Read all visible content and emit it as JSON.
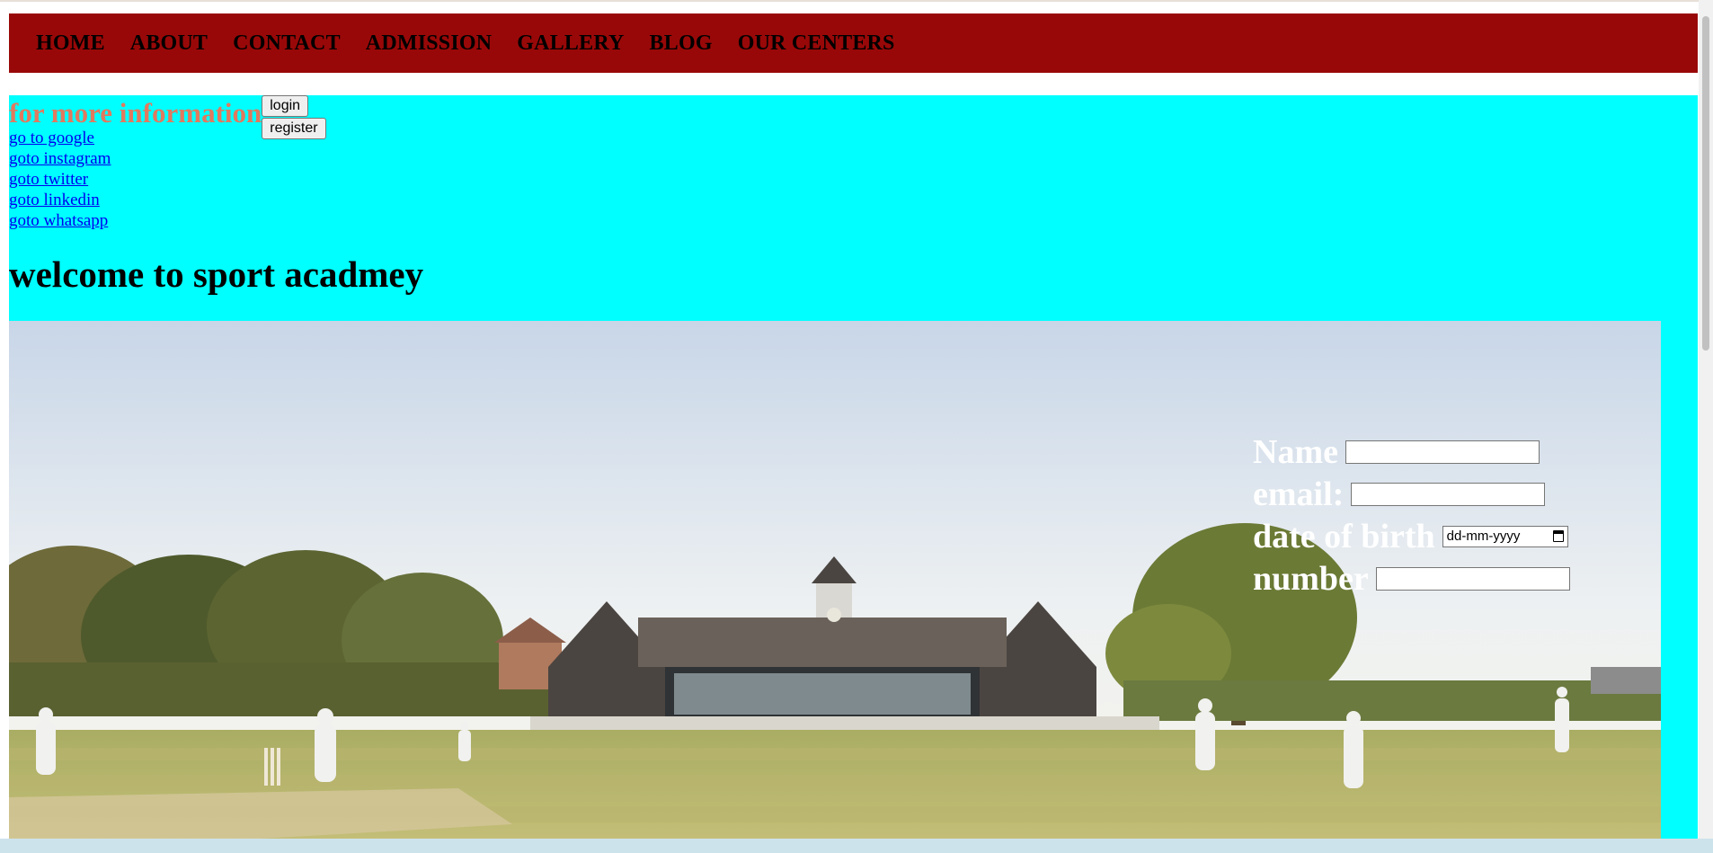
{
  "nav": {
    "items": [
      "HOME",
      "ABOUT",
      "CONTACT",
      "ADMISSION",
      "GALLERY",
      "BLOG",
      "OUR CENTERS"
    ]
  },
  "info": {
    "heading": "for more information",
    "login_label": "login",
    "register_label": "register"
  },
  "links": [
    "go to google",
    "goto instagram",
    "goto twitter",
    "goto linkedin",
    "goto whatsapp"
  ],
  "welcome": "welcome to sport acadmey",
  "form": {
    "name_label": "Name",
    "email_label": "email:",
    "dob_label": "date of birth",
    "dob_placeholder": "dd-mm-yyyy",
    "number_label": "number"
  },
  "colors": {
    "navbar": "#990808",
    "section_bg": "#00ffff",
    "heading": "#e07a5f",
    "link": "#0000ee"
  },
  "icons": {
    "date_picker": "calendar-icon"
  }
}
